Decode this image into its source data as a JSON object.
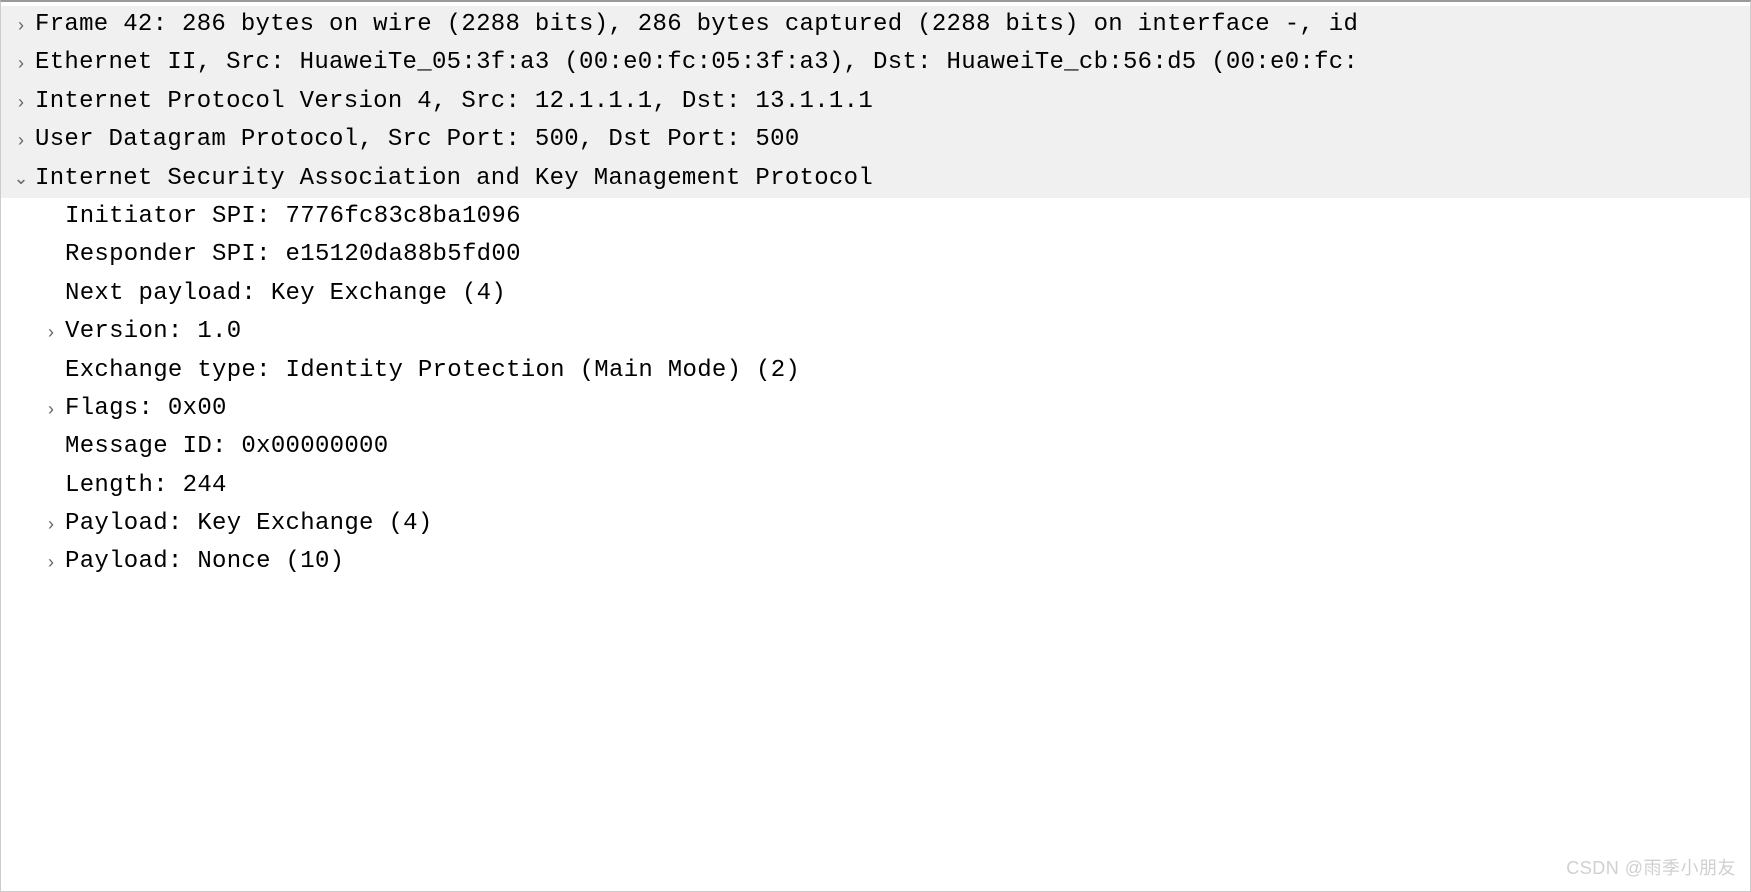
{
  "tree": {
    "rows": [
      {
        "indent": 0,
        "toggle": "closed",
        "highlight": true,
        "text": "Frame 42: 286 bytes on wire (2288 bits), 286 bytes captured (2288 bits) on interface -, id"
      },
      {
        "indent": 0,
        "toggle": "closed",
        "highlight": true,
        "text": "Ethernet II, Src: HuaweiTe_05:3f:a3 (00:e0:fc:05:3f:a3), Dst: HuaweiTe_cb:56:d5 (00:e0:fc:"
      },
      {
        "indent": 0,
        "toggle": "closed",
        "highlight": true,
        "text": "Internet Protocol Version 4, Src: 12.1.1.1, Dst: 13.1.1.1"
      },
      {
        "indent": 0,
        "toggle": "closed",
        "highlight": true,
        "text": "User Datagram Protocol, Src Port: 500, Dst Port: 500"
      },
      {
        "indent": 0,
        "toggle": "open",
        "highlight": true,
        "text": "Internet Security Association and Key Management Protocol"
      },
      {
        "indent": 1,
        "toggle": "none",
        "highlight": false,
        "text": "Initiator SPI: 7776fc83c8ba1096"
      },
      {
        "indent": 1,
        "toggle": "none",
        "highlight": false,
        "text": "Responder SPI: e15120da88b5fd00"
      },
      {
        "indent": 1,
        "toggle": "none",
        "highlight": false,
        "text": "Next payload: Key Exchange (4)"
      },
      {
        "indent": 1,
        "toggle": "closed",
        "highlight": false,
        "text": "Version: 1.0"
      },
      {
        "indent": 1,
        "toggle": "none",
        "highlight": false,
        "text": "Exchange type: Identity Protection (Main Mode) (2)"
      },
      {
        "indent": 1,
        "toggle": "closed",
        "highlight": false,
        "text": "Flags: 0x00"
      },
      {
        "indent": 1,
        "toggle": "none",
        "highlight": false,
        "text": "Message ID: 0x00000000"
      },
      {
        "indent": 1,
        "toggle": "none",
        "highlight": false,
        "text": "Length: 244"
      },
      {
        "indent": 1,
        "toggle": "closed",
        "highlight": false,
        "text": "Payload: Key Exchange (4)"
      },
      {
        "indent": 1,
        "toggle": "closed",
        "highlight": false,
        "text": "Payload: Nonce (10)"
      }
    ]
  },
  "icons": {
    "closed": "›",
    "open": "⌄",
    "none": "·"
  },
  "watermark": "CSDN @雨季小朋友"
}
